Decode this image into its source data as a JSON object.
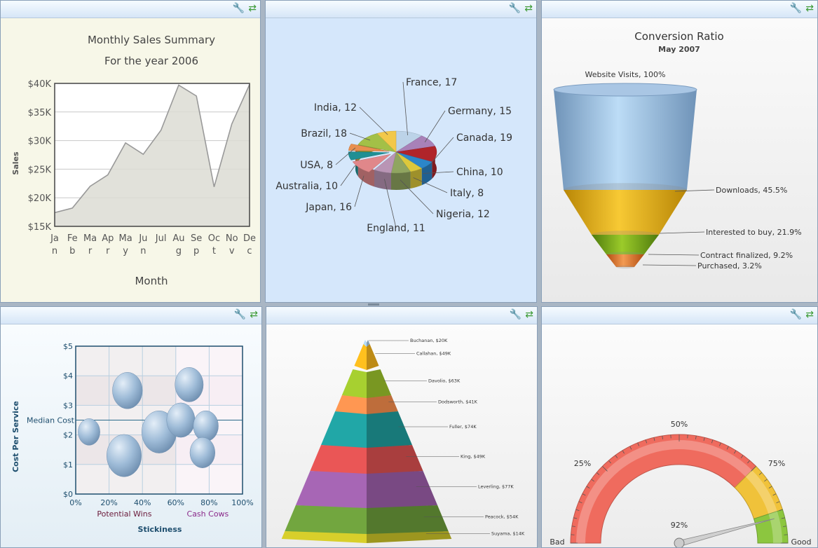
{
  "panels": {
    "wrench_icon": "wrench-icon",
    "refresh_icon": "refresh-icon"
  },
  "sales": {
    "title": "Monthly Sales Summary",
    "subtitle": "For the year 2006",
    "ylabel": "Sales",
    "xlabel": "Month",
    "ytick_labels": [
      "$15K",
      "$20K",
      "$25K",
      "$30K",
      "$35K",
      "$40K"
    ],
    "xtick_lines": [
      [
        "Ja",
        "n"
      ],
      [
        "Fe",
        "b"
      ],
      [
        "Ma",
        "r"
      ],
      [
        "Ap",
        "r"
      ],
      [
        "Ma",
        "y"
      ],
      [
        "Ju",
        "n"
      ],
      [
        "Jul",
        ""
      ],
      [
        "Au",
        "g"
      ],
      [
        "Se",
        "p"
      ],
      [
        "Oc",
        "t"
      ],
      [
        "No",
        "v"
      ],
      [
        "De",
        "c"
      ]
    ]
  },
  "chart_data": [
    {
      "type": "area",
      "title": "Monthly Sales Summary",
      "subtitle": "For the year 2006",
      "xlabel": "Month",
      "ylabel": "Sales",
      "categories": [
        "Jan",
        "Feb",
        "Mar",
        "Apr",
        "May",
        "Jun",
        "Jul",
        "Aug",
        "Sep",
        "Oct",
        "Nov",
        "Dec"
      ],
      "values": [
        17400,
        18200,
        22000,
        24000,
        29600,
        27600,
        31800,
        39700,
        37800,
        21900,
        32900,
        39800
      ],
      "ylim": [
        15000,
        40000
      ],
      "grid": true,
      "colors": {
        "fill": "#e8e8e2",
        "line": "#999999",
        "bg": "#f7f7e8"
      }
    },
    {
      "type": "pie",
      "style": "3d",
      "slices": [
        {
          "label": "France, 17",
          "value": 17,
          "color": "#bcd3e8"
        },
        {
          "label": "Germany, 15",
          "value": 15,
          "color": "#a881b8"
        },
        {
          "label": "Canada, 19",
          "value": 19,
          "color": "#b0242a"
        },
        {
          "label": "China, 10",
          "value": 10,
          "color": "#2c86c9"
        },
        {
          "label": "Italy, 8",
          "value": 8,
          "color": "#dcc83c"
        },
        {
          "label": "Nigeria, 12",
          "value": 12,
          "color": "#90a560"
        },
        {
          "label": "England, 11",
          "value": 11,
          "color": "#b995b5"
        },
        {
          "label": "Japan, 16",
          "value": 16,
          "color": "#e0878a"
        },
        {
          "label": "Australia, 10",
          "value": 10,
          "color": "#1f8f93"
        },
        {
          "label": "USA, 8",
          "value": 8,
          "color": "#e88f4f"
        },
        {
          "label": "Brazil, 18",
          "value": 18,
          "color": "#a3c047"
        },
        {
          "label": "India, 12",
          "value": 12,
          "color": "#f2c84a"
        }
      ]
    },
    {
      "type": "funnel",
      "title": "Conversion Ratio",
      "subtitle": "May 2007",
      "stages": [
        {
          "label": "Website Visits, 100%",
          "value": 100,
          "color": "#8ab4dc"
        },
        {
          "label": "Downloads, 45.5%",
          "value": 45.5,
          "color": "#e8b510"
        },
        {
          "label": "Interested to buy, 21.9%",
          "value": 21.9,
          "color": "#7aa81c"
        },
        {
          "label": "Contract finalized, 9.2%",
          "value": 9.2,
          "color": "#e8782a"
        },
        {
          "label": "Purchased, 3.2%",
          "value": 3.2,
          "color": "#e8782a"
        }
      ]
    },
    {
      "type": "scatter",
      "style": "bubble",
      "xlabel": "Stickiness",
      "ylabel": "Cost Per Service",
      "xtick_labels": [
        "0%",
        "20%",
        "40%",
        "60%",
        "80%",
        "100%"
      ],
      "ytick_labels": [
        "$0",
        "$1",
        "$2",
        "$3",
        "$4",
        "$5"
      ],
      "xlim": [
        0,
        100
      ],
      "ylim": [
        0,
        5
      ],
      "median": {
        "label": "Median Cost",
        "value": 2.5
      },
      "quadrant_labels": [
        {
          "text": "Potential Wins",
          "x": 30,
          "color": "#6a1a3a"
        },
        {
          "text": "Cash Cows",
          "x": 80,
          "color": "#8a2a8a"
        }
      ],
      "points": [
        {
          "x": 8,
          "y": 2.1,
          "size": 0.5
        },
        {
          "x": 31,
          "y": 3.5,
          "size": 1
        },
        {
          "x": 29,
          "y": 1.3,
          "size": 1.3
        },
        {
          "x": 50,
          "y": 2.1,
          "size": 1.3
        },
        {
          "x": 63,
          "y": 2.5,
          "size": 0.9
        },
        {
          "x": 68,
          "y": 3.7,
          "size": 0.9
        },
        {
          "x": 78,
          "y": 2.3,
          "size": 0.7
        },
        {
          "x": 76,
          "y": 1.4,
          "size": 0.7
        }
      ]
    },
    {
      "type": "pyramid",
      "levels": [
        {
          "label": "Buchanan, $20K",
          "value": 20,
          "color": "#a8cce8"
        },
        {
          "label": "Callahan, $49K",
          "value": 49,
          "color": "#f2b21c"
        },
        {
          "label": "Davolio, $63K",
          "value": 63,
          "color": "#9bc12c"
        },
        {
          "label": "Dodsworth, $41K",
          "value": 41,
          "color": "#f48c4c"
        },
        {
          "label": "Fuller, $74K",
          "value": 74,
          "color": "#1f9b9b"
        },
        {
          "label": "King, $49K",
          "value": 49,
          "color": "#d95050"
        },
        {
          "label": "Leverling, $77K",
          "value": 77,
          "color": "#9b5ea8"
        },
        {
          "label": "Peacock, $54K",
          "value": 54,
          "color": "#6a9a3a"
        },
        {
          "label": "Suyama, $14K",
          "value": 14,
          "color": "#c8c028"
        }
      ]
    },
    {
      "type": "gauge",
      "value": 92,
      "min_label": "Bad",
      "max_label": "Good",
      "tick_labels": [
        "25%",
        "50%",
        "75%"
      ],
      "ranges": [
        {
          "from": 0,
          "to": 75,
          "color": "#ef6b5e"
        },
        {
          "from": 75,
          "to": 90,
          "color": "#f0c23a"
        },
        {
          "from": 90,
          "to": 100,
          "color": "#8cc63f"
        }
      ]
    }
  ]
}
